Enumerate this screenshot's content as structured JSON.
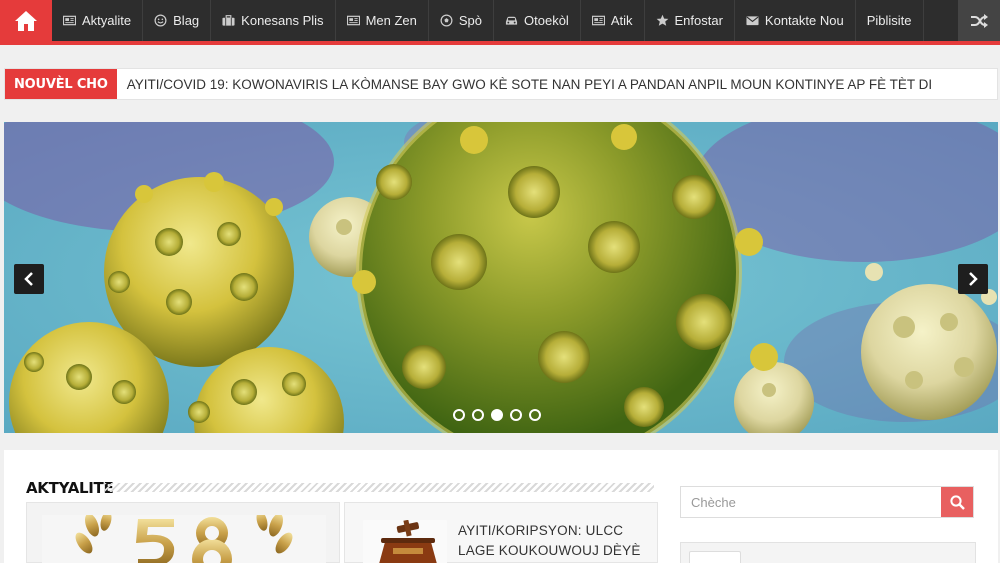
{
  "colors": {
    "accent": "#e53b3b",
    "nav_bg": "#2d2d2d",
    "search_button": "#e86060"
  },
  "nav": {
    "home_icon": "home-icon",
    "items": [
      {
        "label": "Aktyalite",
        "icon": "newspaper-icon"
      },
      {
        "label": "Blag",
        "icon": "smiley-icon"
      },
      {
        "label": "Konesans Plis",
        "icon": "briefcase-icon"
      },
      {
        "label": "Men Zen",
        "icon": "newspaper-icon"
      },
      {
        "label": "Spò",
        "icon": "soccer-ball-icon"
      },
      {
        "label": "Otoekòl",
        "icon": "car-icon"
      },
      {
        "label": "Atik",
        "icon": "newspaper-icon"
      },
      {
        "label": "Enfostar",
        "icon": "star-icon"
      },
      {
        "label": "Kontakte Nou",
        "icon": "envelope-icon"
      },
      {
        "label": "Piblisite",
        "icon": ""
      }
    ],
    "shuffle_icon": "shuffle-icon"
  },
  "ticker": {
    "label": "NOUVÈL CHO",
    "headline": "AYITI/COVID 19: KOWONAVIRIS LA KÒMANSE BAY GWO KÈ SOTE NAN PEYI A PANDAN ANPIL MOUN KONTINYE AP FÈ TÈT DI"
  },
  "slider": {
    "slide_count": 5,
    "active_slide": 3
  },
  "main": {
    "section_title": "AKTYALITE",
    "articles": [
      {
        "title": "AYITI/KORIPSYON: ULCC LAGE KOUKOUWOUJ DÈYÈ ADMINISTRATÈ PUBLIK"
      }
    ]
  },
  "sidebar": {
    "search_placeholder": "Chèche"
  }
}
